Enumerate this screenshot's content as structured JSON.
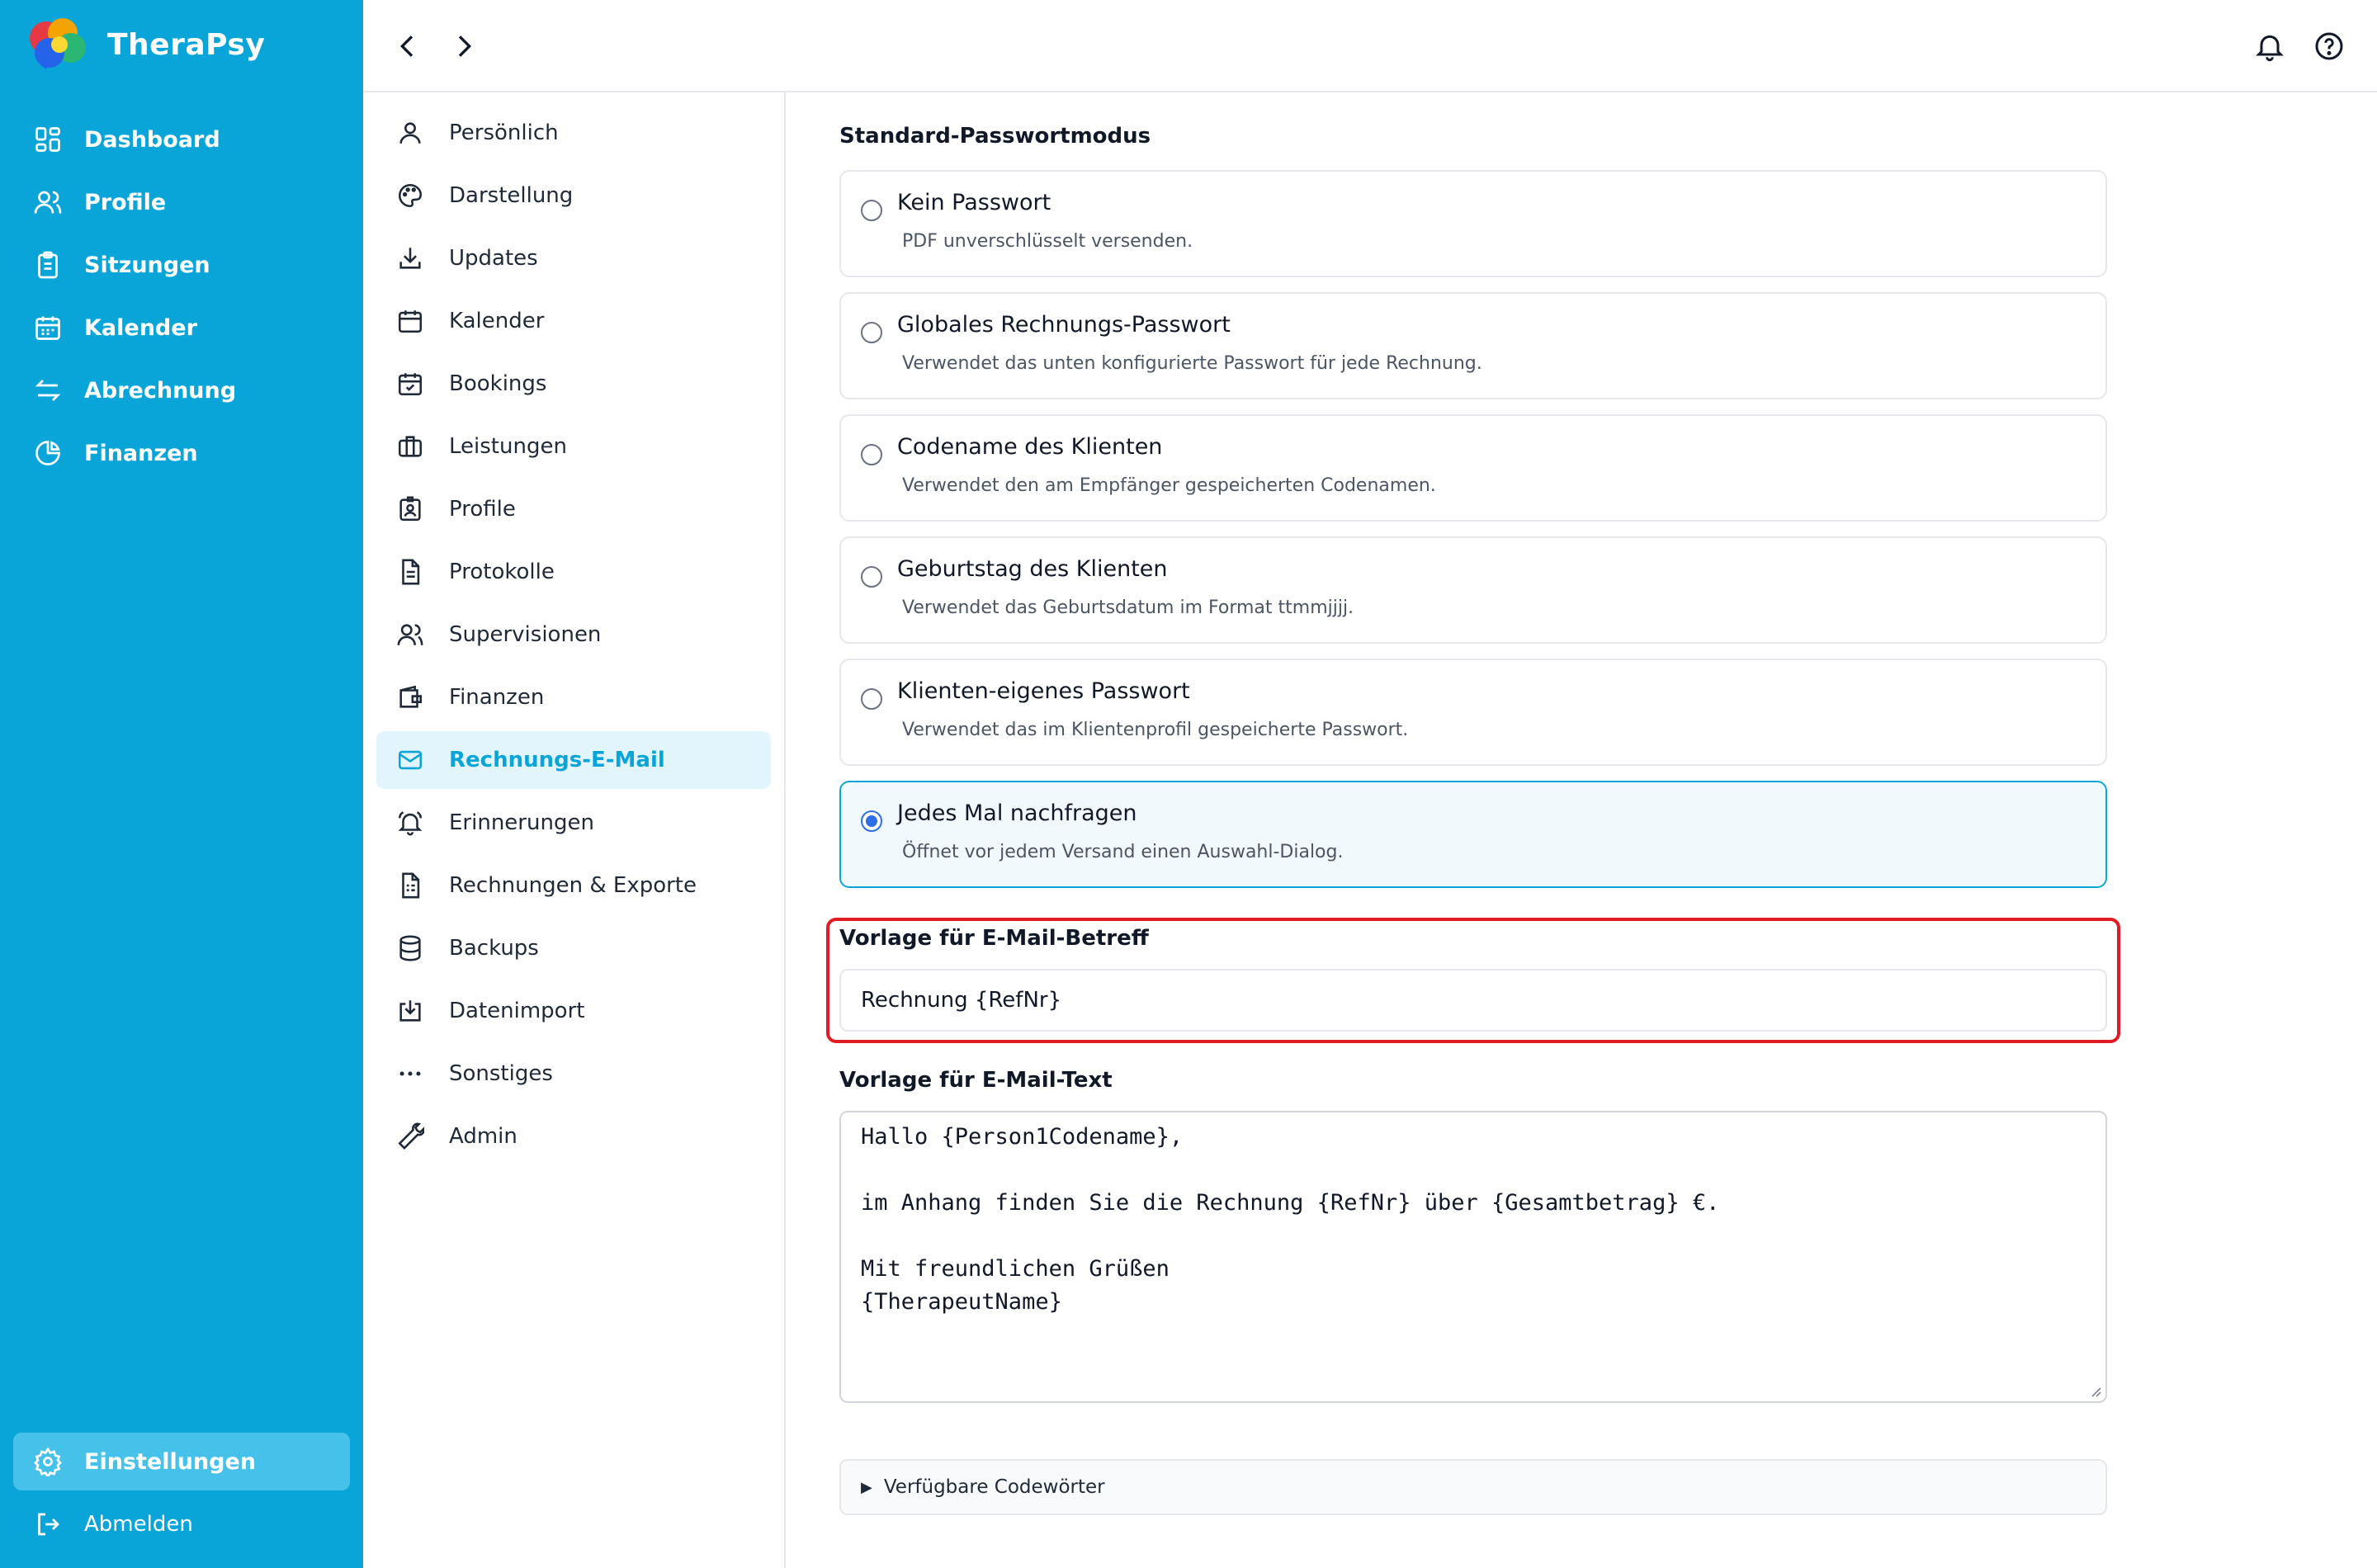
{
  "app": {
    "name": "TheraPsy"
  },
  "sidebar": {
    "items": [
      {
        "label": "Dashboard",
        "icon": "dashboard-grid-icon"
      },
      {
        "label": "Profile",
        "icon": "users-icon"
      },
      {
        "label": "Sitzungen",
        "icon": "clipboard-icon"
      },
      {
        "label": "Kalender",
        "icon": "calendar-icon"
      },
      {
        "label": "Abrechnung",
        "icon": "arrows-exchange-icon"
      },
      {
        "label": "Finanzen",
        "icon": "pie-chart-icon"
      }
    ],
    "settings_label": "Einstellungen",
    "logout_label": "Abmelden"
  },
  "submenu": {
    "items": [
      {
        "label": "Persönlich",
        "icon": "user-icon"
      },
      {
        "label": "Darstellung",
        "icon": "palette-icon"
      },
      {
        "label": "Updates",
        "icon": "download-icon"
      },
      {
        "label": "Kalender",
        "icon": "calendar-icon"
      },
      {
        "label": "Bookings",
        "icon": "calendar-check-icon"
      },
      {
        "label": "Leistungen",
        "icon": "briefcase-icon"
      },
      {
        "label": "Profile",
        "icon": "id-badge-icon"
      },
      {
        "label": "Protokolle",
        "icon": "document-icon"
      },
      {
        "label": "Supervisionen",
        "icon": "users-icon"
      },
      {
        "label": "Finanzen",
        "icon": "wallet-icon"
      },
      {
        "label": "Rechnungs-E-Mail",
        "icon": "mail-icon"
      },
      {
        "label": "Erinnerungen",
        "icon": "bell-icon"
      },
      {
        "label": "Rechnungen & Exporte",
        "icon": "invoice-icon"
      },
      {
        "label": "Backups",
        "icon": "database-icon"
      },
      {
        "label": "Datenimport",
        "icon": "import-icon"
      },
      {
        "label": "Sonstiges",
        "icon": "more-dots-icon"
      },
      {
        "label": "Admin",
        "icon": "wrench-icon"
      }
    ],
    "active_index": 10
  },
  "password_mode": {
    "label": "Standard-Passwortmodus",
    "options": [
      {
        "title": "Kein Passwort",
        "description": "PDF unverschlüsselt versenden."
      },
      {
        "title": "Globales Rechnungs-Passwort",
        "description": "Verwendet das unten konfigurierte Passwort für jede Rechnung."
      },
      {
        "title": "Codename des Klienten",
        "description": "Verwendet den am Empfänger gespeicherten Codenamen."
      },
      {
        "title": "Geburtstag des Klienten",
        "description": "Verwendet das Geburtsdatum im Format ttmmjjjj."
      },
      {
        "title": "Klienten-eigenes Passwort",
        "description": "Verwendet das im Klientenprofil gespeicherte Passwort."
      },
      {
        "title": "Jedes Mal nachfragen",
        "description": "Öffnet vor jedem Versand einen Auswahl-Dialog."
      }
    ],
    "selected_index": 5
  },
  "subject": {
    "label": "Vorlage für E-Mail-Betreff",
    "value": "Rechnung {RefNr}"
  },
  "body": {
    "label": "Vorlage für E-Mail-Text",
    "value": "Hallo {Person1Codename},\n\nim Anhang finden Sie die Rechnung {RefNr} über {Gesamtbetrag} €.\n\nMit freundlichen Grüßen\n{TherapeutName}"
  },
  "codewords": {
    "label": "Verfügbare Codewörter"
  },
  "colors": {
    "accent": "#0aa5d8",
    "highlight": "#e01b24",
    "active_bg": "#e3f5fc"
  }
}
